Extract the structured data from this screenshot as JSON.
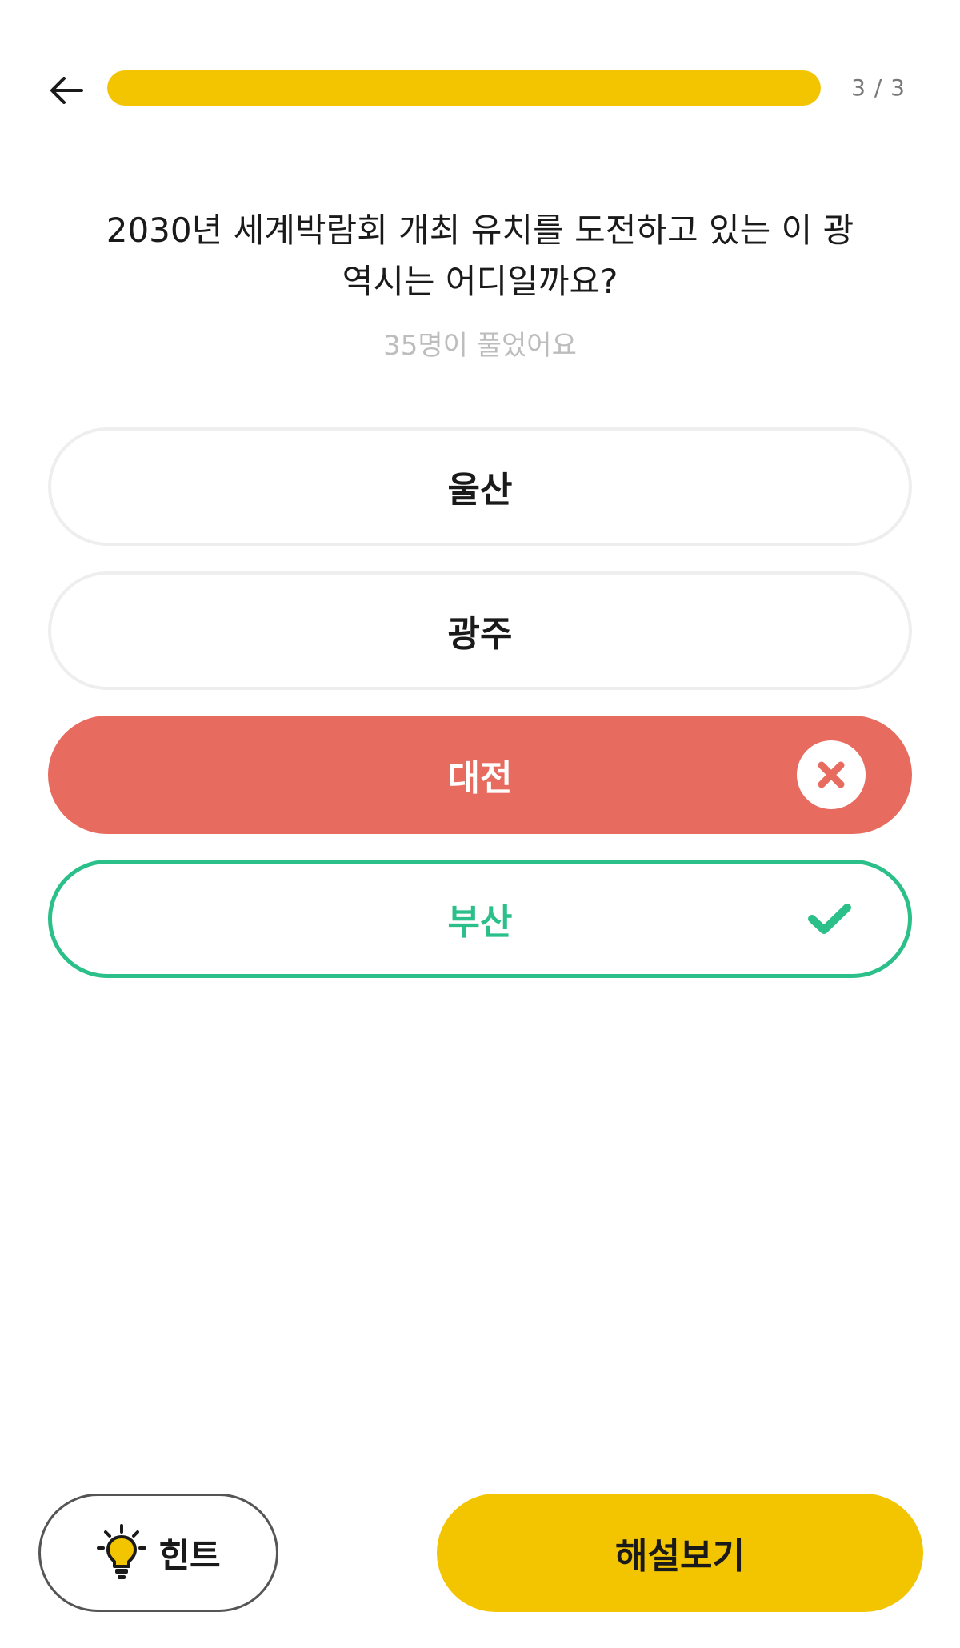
{
  "colors": {
    "accent": "#f2c500",
    "wrong": "#e86b5f",
    "correct": "#2bbf8a"
  },
  "header": {
    "back_icon": "arrow-left-icon",
    "progress_text": "3 / 3",
    "progress_fraction": 1.0
  },
  "question": {
    "line1": "2030년 세계박람회 개최 유치를 도전하고 있는 이 광",
    "line2": "역시는 어디일까요?",
    "solved_count": "35명이 풀었어요"
  },
  "options": [
    {
      "label": "울산",
      "state": "neutral"
    },
    {
      "label": "광주",
      "state": "neutral"
    },
    {
      "label": "대전",
      "state": "wrong",
      "icon": "x-circle-icon"
    },
    {
      "label": "부산",
      "state": "correct",
      "icon": "checkmark-icon"
    }
  ],
  "footer": {
    "hint_label": "힌트",
    "hint_icon": "lightbulb-icon",
    "explain_label": "해설보기"
  }
}
